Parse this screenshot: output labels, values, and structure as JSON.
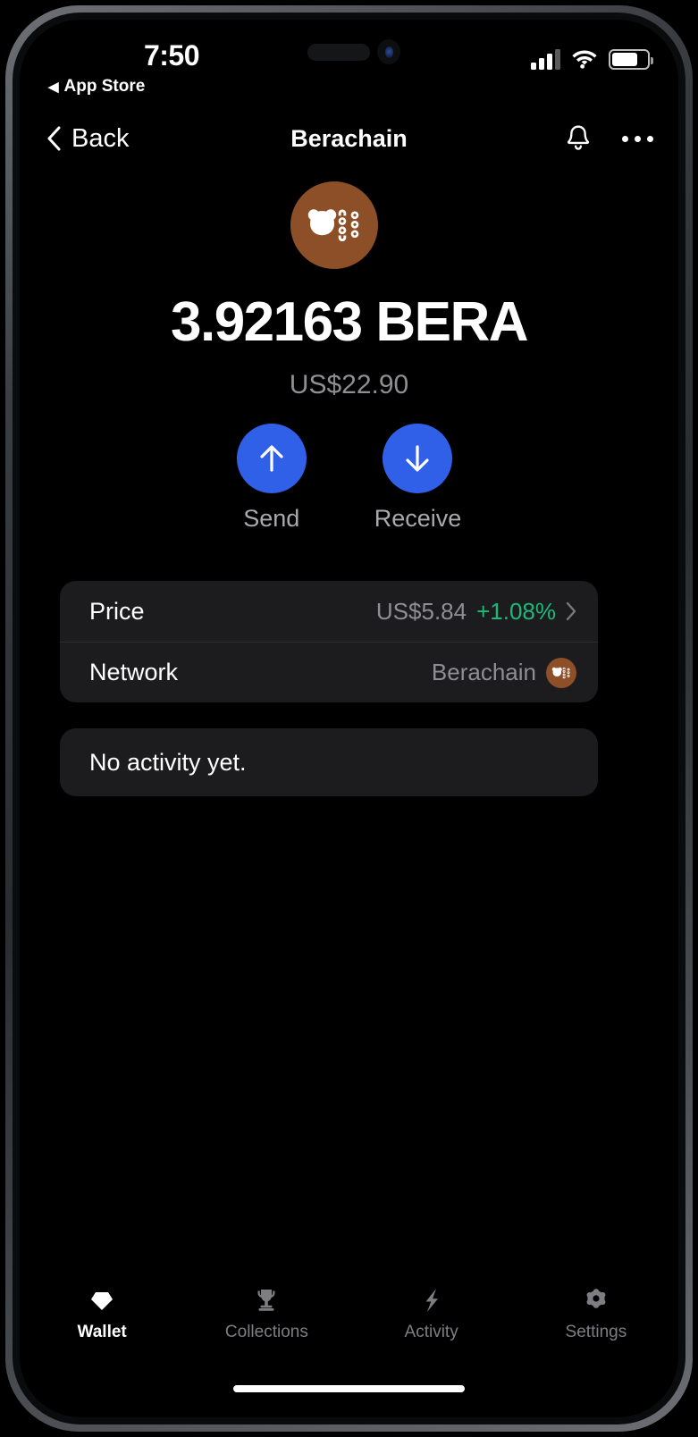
{
  "status_bar": {
    "time": "7:50",
    "return_label": "App Store",
    "return_arrow": "◀",
    "signal_icon": "cellular-signal-icon",
    "wifi_icon": "wifi-icon",
    "battery_icon": "battery-icon",
    "battery_level": "74%"
  },
  "nav": {
    "back_label": "Back",
    "title": "Berachain",
    "bell_icon": "bell-icon",
    "more_icon": "more-options-icon"
  },
  "token": {
    "logo_icon": "berachain-bear-logo-icon",
    "balance": "3.92163 BERA",
    "fiat_value": "US$22.90"
  },
  "actions": [
    {
      "label": "Send",
      "icon": "arrow-up-icon"
    },
    {
      "label": "Receive",
      "icon": "arrow-down-icon"
    }
  ],
  "info_rows": {
    "price": {
      "label": "Price",
      "value": "US$5.84",
      "change": "+1.08%",
      "chevron_icon": "chevron-right-icon"
    },
    "network": {
      "label": "Network",
      "value": "Berachain",
      "badge_icon": "berachain-bear-logo-icon"
    }
  },
  "activity": {
    "empty_text": "No activity yet."
  },
  "tabs": [
    {
      "label": "Wallet",
      "icon": "diamond-icon",
      "active": true
    },
    {
      "label": "Collections",
      "icon": "trophy-icon",
      "active": false
    },
    {
      "label": "Activity",
      "icon": "lightning-icon",
      "active": false
    },
    {
      "label": "Settings",
      "icon": "gear-icon",
      "active": false
    }
  ],
  "colors": {
    "accent_blue": "#3060e8",
    "brand_brown": "#8d4f28",
    "positive_green": "#1db97a",
    "card_bg": "#1c1c1e",
    "screen_bg": "#000000"
  }
}
